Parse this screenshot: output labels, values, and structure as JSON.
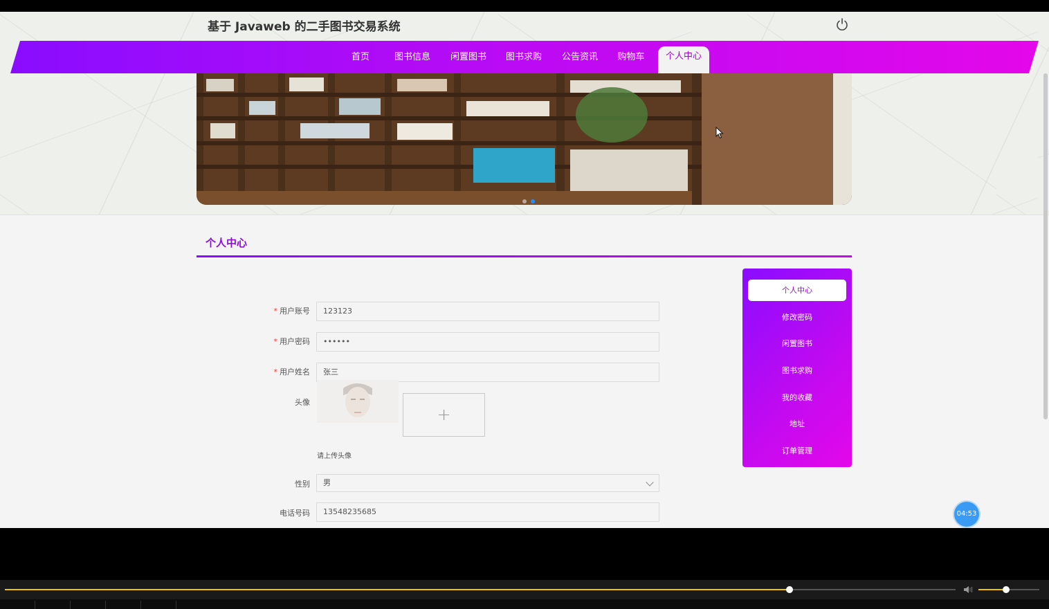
{
  "header": {
    "site_title": "基于 Javaweb 的二手图书交易系统"
  },
  "nav": {
    "items": [
      "首页",
      "图书信息",
      "闲置图书",
      "图书求购",
      "公告资讯",
      "购物车",
      "个人中心"
    ],
    "active_index": 6
  },
  "banner": {
    "slides": 2,
    "active_slide": 1
  },
  "section": {
    "title": "个人中心"
  },
  "form": {
    "account_label": "用户账号",
    "account_value": "123123",
    "password_label": "用户密码",
    "password_value": "••••••",
    "name_label": "用户姓名",
    "name_value": "张三",
    "avatar_label": "头像",
    "upload_plus": "+",
    "upload_hint": "请上传头像",
    "gender_label": "性别",
    "gender_value": "男",
    "phone_label": "电话号码",
    "phone_value": "13548235685"
  },
  "sidebar": {
    "items": [
      "个人中心",
      "修改密码",
      "闲置图书",
      "图书求购",
      "我的收藏",
      "地址",
      "订单管理"
    ],
    "active_index": 0
  },
  "timer": {
    "text": "04:53"
  },
  "player": {
    "progress": 0.825,
    "volume": 0.45
  },
  "colors": {
    "accent_start": "#8a0cff",
    "accent_end": "#e407ea",
    "active_text": "#a00bd8"
  }
}
